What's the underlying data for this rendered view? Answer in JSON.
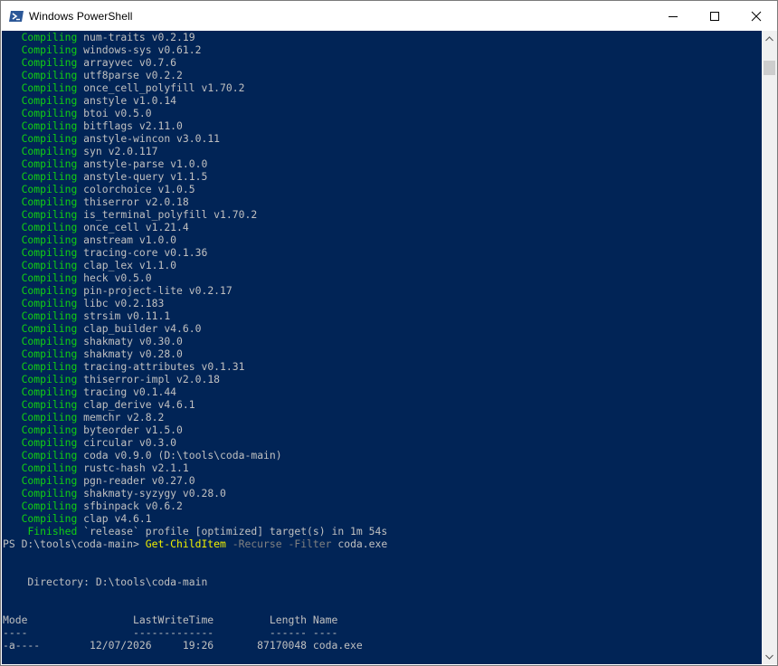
{
  "window": {
    "title": "Windows PowerShell",
    "icons": {
      "app": "powershell-icon",
      "minimize": "minimize-icon",
      "maximize": "maximize-icon",
      "close": "close-icon"
    }
  },
  "colors": {
    "console_bg": "#012456",
    "compiling": "#12d012",
    "command": "#f0f000",
    "param": "#808080",
    "text": "#c0c0c0"
  },
  "compile": {
    "label": "Compiling",
    "crates": [
      "num-traits v0.2.19",
      "windows-sys v0.61.2",
      "arrayvec v0.7.6",
      "utf8parse v0.2.2",
      "once_cell_polyfill v1.70.2",
      "anstyle v1.0.14",
      "btoi v0.5.0",
      "bitflags v2.11.0",
      "anstyle-wincon v3.0.11",
      "syn v2.0.117",
      "anstyle-parse v1.0.0",
      "anstyle-query v1.1.5",
      "colorchoice v1.0.5",
      "thiserror v2.0.18",
      "is_terminal_polyfill v1.70.2",
      "once_cell v1.21.4",
      "anstream v1.0.0",
      "tracing-core v0.1.36",
      "clap_lex v1.1.0",
      "heck v0.5.0",
      "pin-project-lite v0.2.17",
      "libc v0.2.183",
      "strsim v0.11.1",
      "clap_builder v4.6.0",
      "shakmaty v0.30.0",
      "shakmaty v0.28.0",
      "tracing-attributes v0.1.31",
      "thiserror-impl v2.0.18",
      "tracing v0.1.44",
      "clap_derive v4.6.1",
      "memchr v2.8.2",
      "byteorder v1.5.0",
      "circular v0.3.0",
      "coda v0.9.0 (D:\\tools\\coda-main)",
      "rustc-hash v2.1.1",
      "pgn-reader v0.27.0",
      "shakmaty-syzygy v0.28.0",
      "sfbinpack v0.6.2",
      "clap v4.6.1"
    ],
    "finished_label": "Finished",
    "finished_text": "`release` profile [optimized] target(s) in 1m 54s"
  },
  "prompt": {
    "path": "PS D:\\tools\\coda-main> ",
    "command": "Get-ChildItem",
    "param1": "-Recurse",
    "param2": "-Filter",
    "arg": "coda.exe"
  },
  "listing": {
    "directory_line": "    Directory: D:\\tools\\coda-main",
    "header": "Mode                 LastWriteTime         Length Name",
    "underline": "----                 -------------         ------ ----",
    "rows": [
      "-a----        12/07/2026     19:26       87170048 coda.exe"
    ]
  }
}
